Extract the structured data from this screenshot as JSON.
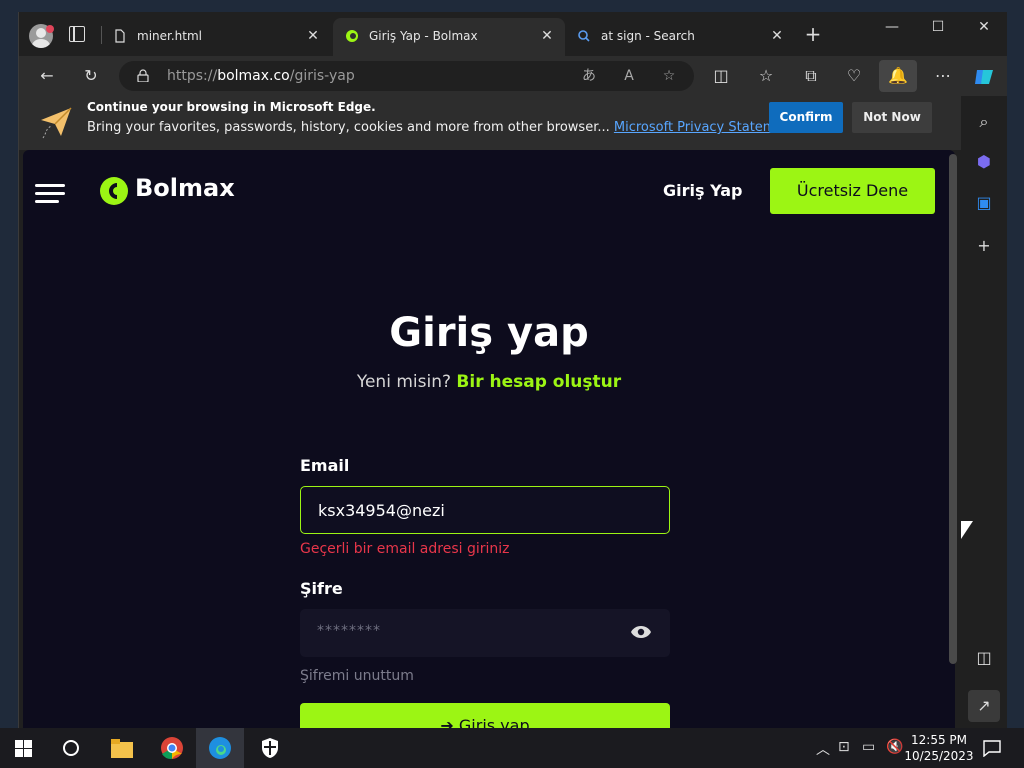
{
  "tabs": [
    {
      "title": "miner.html",
      "icon": "file-icon"
    },
    {
      "title": "Giriş Yap - Bolmax",
      "icon": "bolmax-icon"
    },
    {
      "title": "at sign - Search",
      "icon": "search-icon"
    }
  ],
  "address": {
    "prefix": "https://",
    "host": "bolmax.co",
    "path": "/giris-yap"
  },
  "banner": {
    "title": "Continue your browsing in Microsoft Edge.",
    "body": "Bring your favorites, passwords, history, cookies and more from other browser...",
    "link": "Microsoft Privacy Statement",
    "confirm": "Confirm",
    "not_now": "Not Now"
  },
  "site": {
    "brand": "Bolmax",
    "nav_login": "Giriş Yap",
    "cta": "Ücretsiz Dene",
    "heading": "Giriş yap",
    "sub_prefix": "Yeni misin?",
    "sub_link": "Bir hesap oluştur",
    "email_label": "Email",
    "email_value": "ksx34954@nezi",
    "email_error": "Geçerli bir email adresi giriniz",
    "password_label": "Şifre",
    "password_mask": "********",
    "forgot": "Şifremi unuttum",
    "submit": "Giriş yap"
  },
  "colors": {
    "accent": "#9cf514",
    "error": "#e8364a",
    "page_bg": "#0d0c1d",
    "edge_blue": "#0f6cbd"
  },
  "taskbar": {
    "time": "12:55 PM",
    "date": "10/25/2023"
  }
}
